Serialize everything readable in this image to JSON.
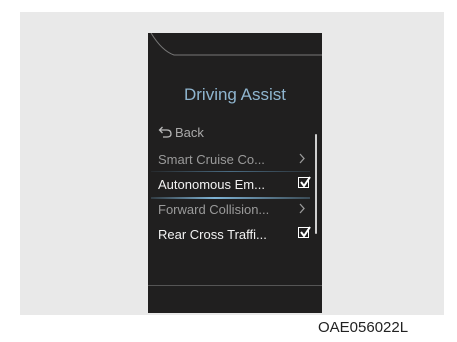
{
  "screen": {
    "title": "Driving Assist",
    "back_label": "Back",
    "menu": [
      {
        "label": "Smart Cruise Co...",
        "control": "chevron",
        "state": "normal"
      },
      {
        "label": "Autonomous Em...",
        "control": "checkbox",
        "checked": true,
        "state": "selected"
      },
      {
        "label": "Forward Collision...",
        "control": "chevron",
        "state": "normal"
      },
      {
        "label": "Rear Cross Traffi...",
        "control": "checkbox",
        "checked": true,
        "state": "normal"
      }
    ]
  },
  "figure_code": "OAE056022L",
  "colors": {
    "screen_bg": "#201f1f",
    "title": "#8fb5cf",
    "highlight": "#7fb3d4"
  }
}
